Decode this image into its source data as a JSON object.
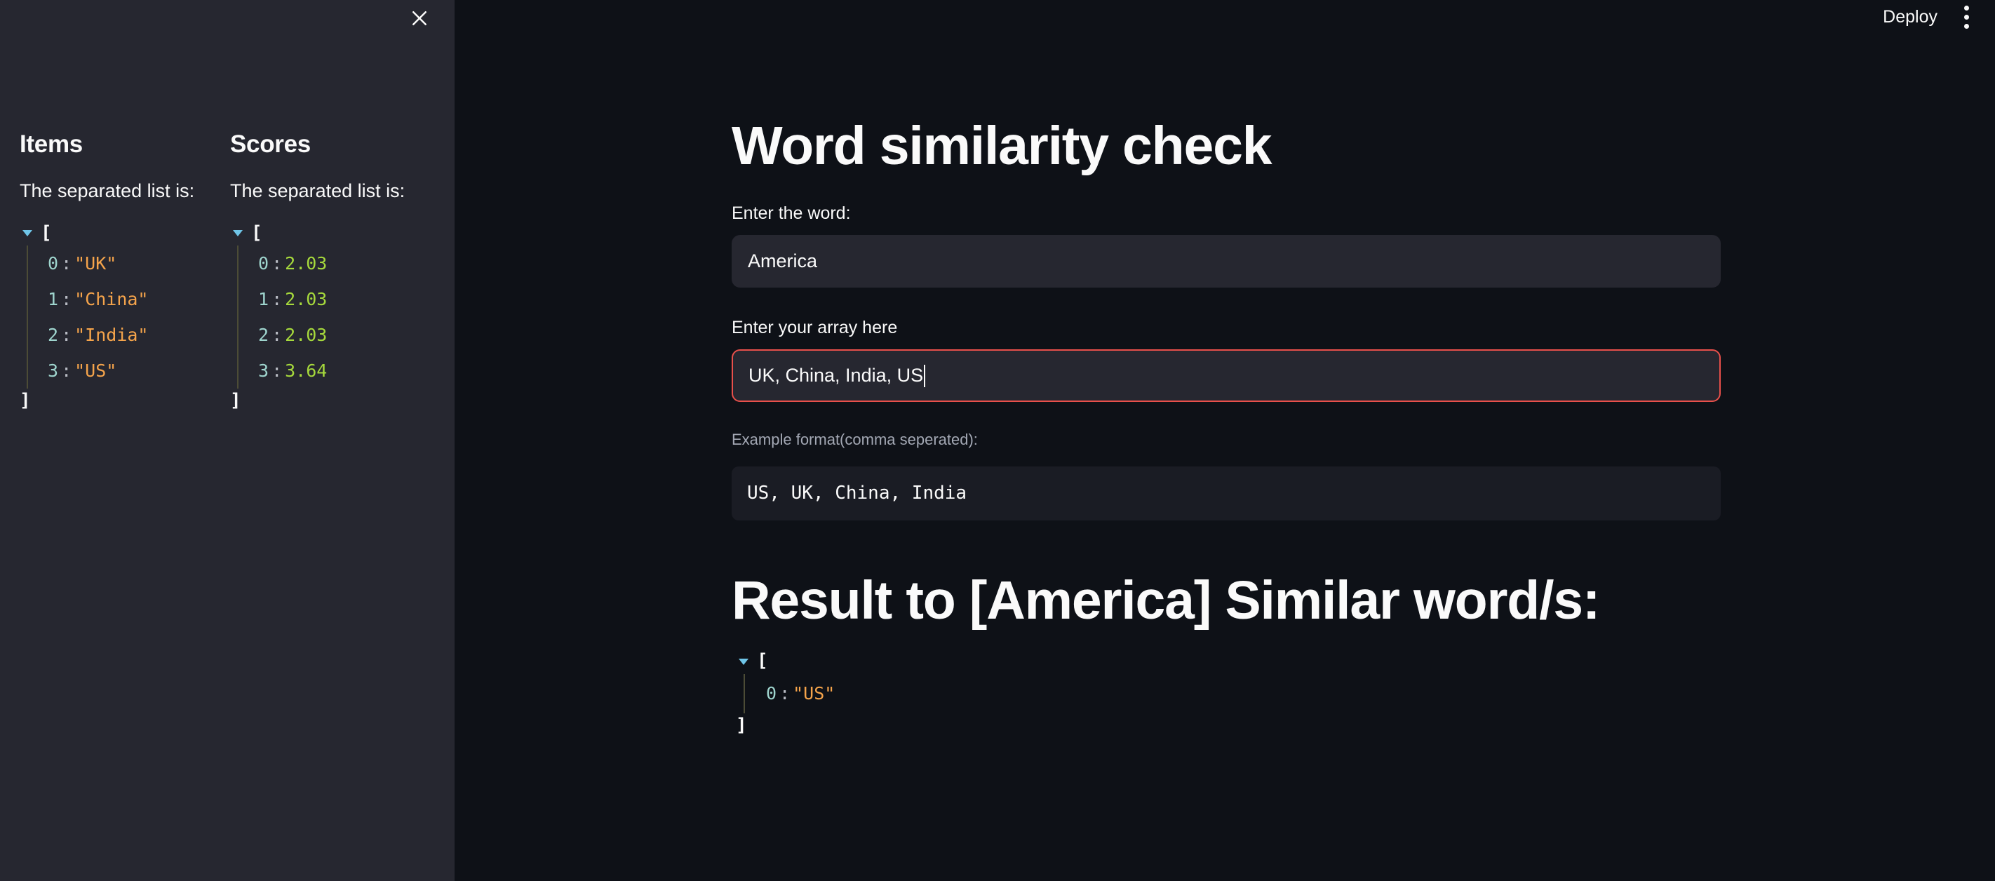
{
  "sidebar": {
    "close_icon": "close-icon",
    "columns": [
      {
        "heading": "Items",
        "subtext": "The separated list is:",
        "open_bracket": "[",
        "close_bracket": "]",
        "entries": [
          {
            "key": "0",
            "colon": ":",
            "value": "\"UK\"",
            "type": "string"
          },
          {
            "key": "1",
            "colon": ":",
            "value": "\"China\"",
            "type": "string"
          },
          {
            "key": "2",
            "colon": ":",
            "value": "\"India\"",
            "type": "string"
          },
          {
            "key": "3",
            "colon": ":",
            "value": "\"US\"",
            "type": "string"
          }
        ]
      },
      {
        "heading": "Scores",
        "subtext": "The separated list is:",
        "open_bracket": "[",
        "close_bracket": "]",
        "entries": [
          {
            "key": "0",
            "colon": ":",
            "value": "2.03",
            "type": "number"
          },
          {
            "key": "1",
            "colon": ":",
            "value": "2.03",
            "type": "number"
          },
          {
            "key": "2",
            "colon": ":",
            "value": "2.03",
            "type": "number"
          },
          {
            "key": "3",
            "colon": ":",
            "value": "3.64",
            "type": "number"
          }
        ]
      }
    ]
  },
  "topbar": {
    "deploy_label": "Deploy",
    "menu_icon": "more-vertical-icon"
  },
  "main": {
    "title": "Word similarity check",
    "word_field": {
      "label": "Enter the word:",
      "value": "America",
      "placeholder": ""
    },
    "array_field": {
      "label": "Enter your array here",
      "value": "UK, China, India, US",
      "placeholder": "",
      "focused": true,
      "border_color": "#E8504B"
    },
    "example_caption": "Example format(comma seperated):",
    "example_code": "US, UK, China, India",
    "result_title": "Result to [America] Similar word/s:",
    "result_json": {
      "open_bracket": "[",
      "close_bracket": "]",
      "entries": [
        {
          "key": "0",
          "colon": ":",
          "value": "\"US\"",
          "type": "string"
        }
      ]
    }
  },
  "colors": {
    "page_bg": "#0E1117",
    "sidebar_bg": "#262730",
    "input_bg": "#262730",
    "code_bg": "#1A1C24",
    "text": "#FAFAFA",
    "muted_text": "#A3A8B4",
    "json_key": "#9FD5CE",
    "json_string": "#F5A44B",
    "json_number": "#A6D93C",
    "caret_blue": "#6FC5E8",
    "focus_red": "#E8504B"
  }
}
